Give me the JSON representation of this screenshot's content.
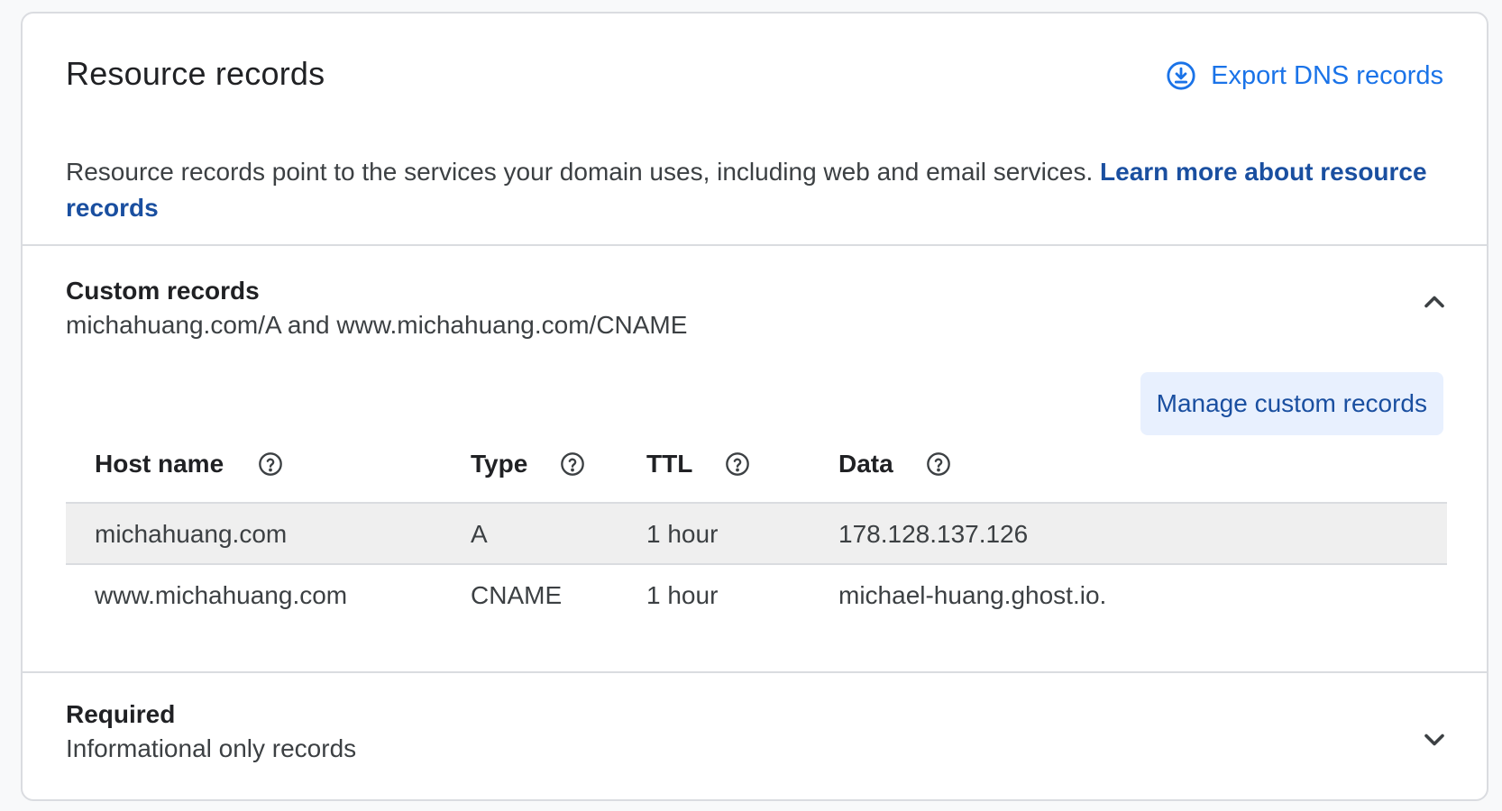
{
  "header": {
    "title": "Resource records",
    "export_label": "Export DNS records",
    "description": "Resource records point to the services your domain uses, including web and email services.",
    "learn_more": "Learn more about resource records"
  },
  "custom_records": {
    "title": "Custom records",
    "subtitle": "michahuang.com/A and www.michahuang.com/CNAME",
    "expanded": true,
    "manage_label": "Manage custom records",
    "columns": [
      "Host name",
      "Type",
      "TTL",
      "Data"
    ],
    "rows": [
      {
        "host": "michahuang.com",
        "type": "A",
        "ttl": "1 hour",
        "data": "178.128.137.126"
      },
      {
        "host": "www.michahuang.com",
        "type": "CNAME",
        "ttl": "1 hour",
        "data": "michael-huang.ghost.io."
      }
    ]
  },
  "required": {
    "title": "Required",
    "subtitle": "Informational only records",
    "expanded": false
  },
  "colors": {
    "accent": "#1a73e8",
    "link": "#1a4fa0",
    "button_bg": "#e8f0fe",
    "row_highlight": "#efefef",
    "border": "#dadce0"
  },
  "icons": {
    "export": "download-circle-icon",
    "help": "help-circle-icon",
    "collapse": "chevron-up-icon",
    "expand": "chevron-down-icon"
  }
}
